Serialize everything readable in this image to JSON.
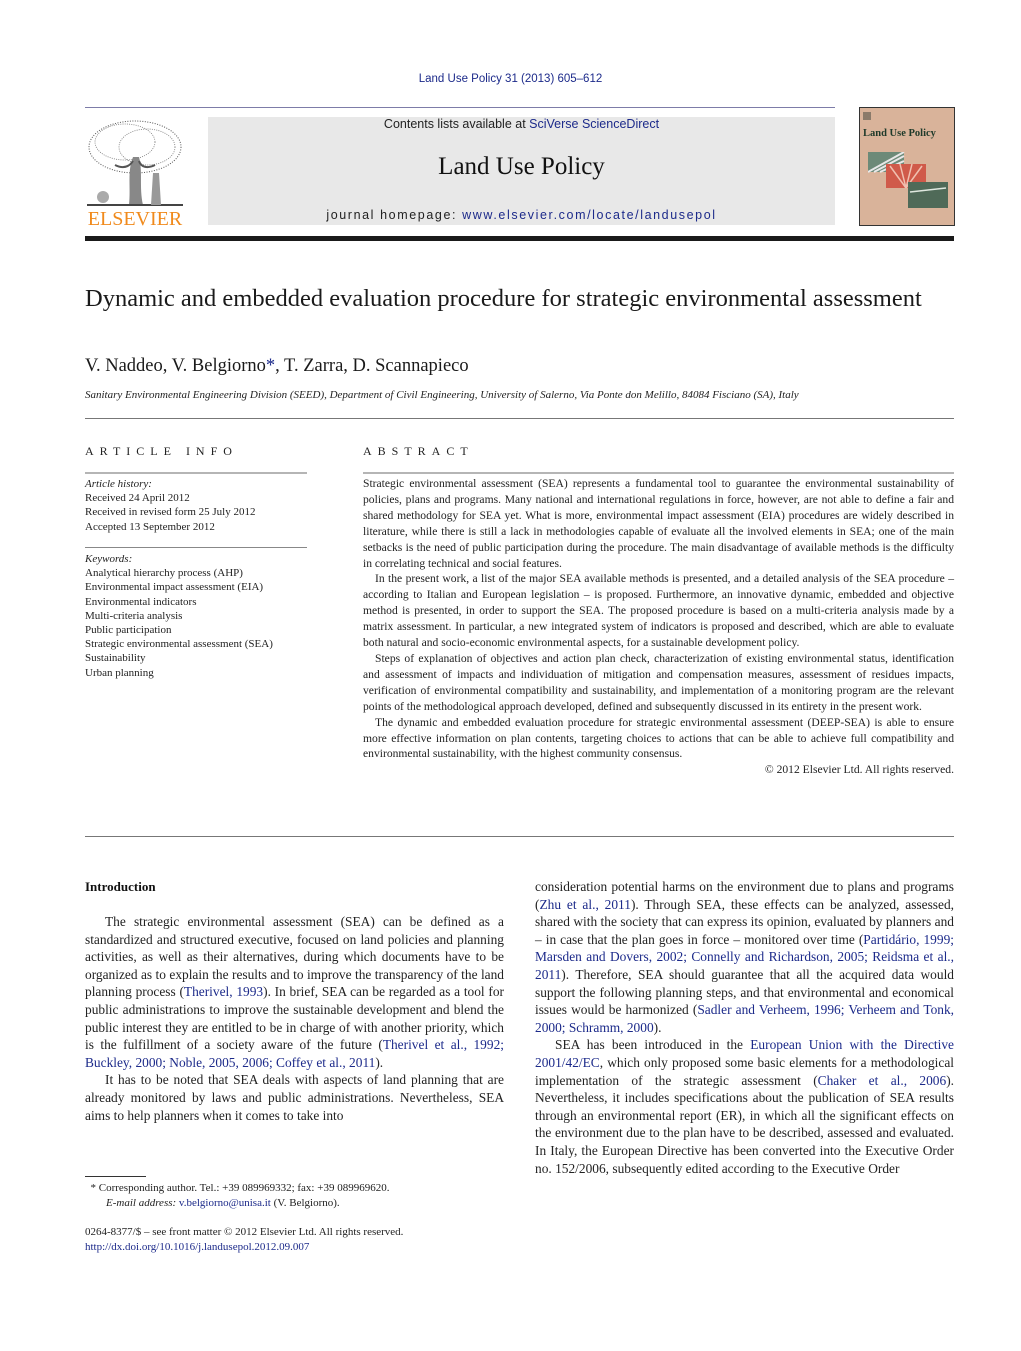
{
  "header": {
    "journal_ref": "Land Use Policy 31 (2013) 605–612",
    "contents_prefix": "Contents lists available at ",
    "contents_link": "SciVerse ScienceDirect",
    "journal_title": "Land Use Policy",
    "homepage_prefix": "journal homepage: ",
    "homepage_link": "www.elsevier.com/locate/landusepol",
    "publisher_logo_text": "ELSEVIER",
    "cover_title": "Land Use Policy"
  },
  "article": {
    "title": "Dynamic and embedded evaluation procedure for strategic environmental assessment",
    "authors_before_star": "V. Naddeo, V. Belgiorno",
    "author_star": "*",
    "authors_after_star": ", T. Zarra, D. Scannapieco",
    "affiliation": "Sanitary Environmental Engineering Division (SEED), Department of Civil Engineering, University of Salerno, Via Ponte don Melillo, 84084 Fisciano (SA), Italy"
  },
  "article_info": {
    "heading": "ARTICLE INFO",
    "history_label": "Article history:",
    "history": [
      "Received 24 April 2012",
      "Received in revised form 25 July 2012",
      "Accepted 13 September 2012"
    ],
    "keywords_label": "Keywords:",
    "keywords": [
      "Analytical hierarchy process (AHP)",
      "Environmental impact assessment (EIA)",
      "Environmental indicators",
      "Multi-criteria analysis",
      "Public participation",
      "Strategic environmental assessment (SEA)",
      "Sustainability",
      "Urban planning"
    ]
  },
  "abstract": {
    "heading": "ABSTRACT",
    "paragraphs": [
      "Strategic environmental assessment (SEA) represents a fundamental tool to guarantee the environmental sustainability of policies, plans and programs. Many national and international regulations in force, however, are not able to define a fair and shared methodology for SEA yet. What is more, environmental impact assessment (EIA) procedures are widely described in literature, while there is still a lack in methodologies capable of evaluate all the involved elements in SEA; one of the main setbacks is the need of public participation during the procedure. The main disadvantage of available methods is the difficulty in correlating technical and social features.",
      "In the present work, a list of the major SEA available methods is presented, and a detailed analysis of the SEA procedure – according to Italian and European legislation – is proposed. Furthermore, an innovative dynamic, embedded and objective method is presented, in order to support the SEA. The proposed procedure is based on a multi-criteria analysis made by a matrix assessment. In particular, a new integrated system of indicators is proposed and described, which are able to evaluate both natural and socio-economic environmental aspects, for a sustainable development policy.",
      "Steps of explanation of objectives and action plan check, characterization of existing environmental status, identification and assessment of impacts and individuation of mitigation and compensation measures, assessment of residues impacts, verification of environmental compatibility and sustainability, and implementation of a monitoring program are the relevant points of the methodological approach developed, defined and subsequently discussed in its entirety in the present work.",
      "The dynamic and embedded evaluation procedure for strategic environmental assessment (DEEP-SEA) is able to ensure more effective information on plan contents, targeting choices to actions that can be able to achieve full compatibility and environmental sustainability, with the highest community consensus."
    ],
    "copyright": "© 2012 Elsevier Ltd. All rights reserved."
  },
  "body": {
    "intro_heading": "Introduction",
    "left": {
      "p1_a": "The strategic environmental assessment (SEA) can be defined as a standardized and structured executive, focused on land policies and planning activities, as well as their alternatives, during which documents have to be organized as to explain the results and to improve the transparency of the land planning process (",
      "p1_ref1": "Therivel, 1993",
      "p1_b": "). In brief, SEA can be regarded as a tool for public administrations to improve the sustainable development and blend the public interest they are entitled to be in charge of with another priority, which is the fulfillment of a society aware of the future (",
      "p1_ref2": "Therivel et al., 1992; Buckley, 2000; Noble, 2005, 2006; Coffey et al., 2011",
      "p1_c": ").",
      "p2": "It has to be noted that SEA deals with aspects of land planning that are already monitored by laws and public administrations. Nevertheless, SEA aims to help planners when it comes to take into"
    },
    "right": {
      "p1_a": "consideration potential harms on the environment due to plans and programs (",
      "p1_ref1": "Zhu et al., 2011",
      "p1_b": "). Through SEA, these effects can be analyzed, assessed, shared with the society that can express its opinion, evaluated by planners and – in case that the plan goes in force – monitored over time (",
      "p1_ref2": "Partidário, 1999; Marsden and Dovers, 2002; Connelly and Richardson, 2005; Reidsma et al., 2011",
      "p1_c": "). Therefore, SEA should guarantee that all the acquired data would support the following planning steps, and that environmental and economical issues would be harmonized (",
      "p1_ref3": "Sadler and Verheem, 1996; Verheem and Tonk, 2000; Schramm, 2000",
      "p1_d": ").",
      "p2_a": "SEA has been introduced in the ",
      "p2_ref1": "European Union with the Directive 2001/42/EC",
      "p2_b": ", which only proposed some basic elements for a methodological implementation of the strategic assessment (",
      "p2_ref2": "Chaker et al., 2006",
      "p2_c": "). Nevertheless, it includes specifications about the publication of SEA results through an environmental report (ER), in which all the significant effects on the environment due to the plan have to be described, assessed and evaluated. In Italy, the European Directive has been converted into the Executive Order no. 152/2006, subsequently edited according to the Executive Order"
    }
  },
  "footnote": {
    "star": "*",
    "corresponding": "Corresponding author. Tel.: +39 089969332; fax: +39 089969620.",
    "email_label": "E-mail address:",
    "email": "v.belgiorno@unisa.it",
    "email_name": "(V. Belgiorno)."
  },
  "front_matter": {
    "issn_line": "0264-8377/$ – see front matter © 2012 Elsevier Ltd. All rights reserved.",
    "doi": "http://dx.doi.org/10.1016/j.landusepol.2012.09.007"
  },
  "colors": {
    "link": "#1c2a8a",
    "elsevier_orange": "#f08a1c",
    "banner_bg": "#e8e8e8",
    "cover_bg": "#d9b39a"
  }
}
